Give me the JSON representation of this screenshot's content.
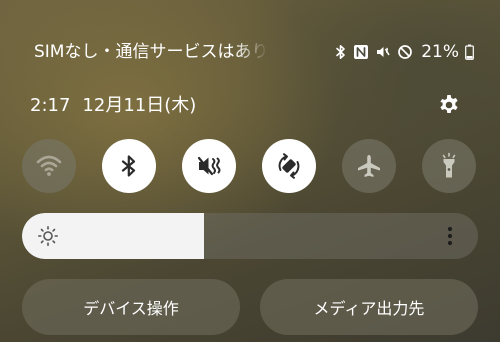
{
  "status_bar": {
    "carrier_text": "SIMなし・通信サービスはあり",
    "battery_percent": "21%",
    "icons": [
      "bluetooth-icon",
      "nfc-icon",
      "vibrate-mute-icon",
      "do-not-disturb-icon",
      "battery-icon"
    ],
    "battery_level": 0.21
  },
  "header": {
    "time": "2:17",
    "date": "12月11日(木)",
    "settings_icon": "gear-icon"
  },
  "quick_toggles": [
    {
      "name": "wifi",
      "icon": "wifi-icon",
      "state": "off"
    },
    {
      "name": "bluetooth",
      "icon": "bluetooth-icon",
      "state": "on"
    },
    {
      "name": "sound-mute",
      "icon": "mute-icon",
      "state": "on"
    },
    {
      "name": "auto-rotate",
      "icon": "auto-rotate-icon",
      "state": "on"
    },
    {
      "name": "airplane-mode",
      "icon": "airplane-icon",
      "state": "off"
    },
    {
      "name": "flashlight",
      "icon": "flashlight-icon",
      "state": "off"
    }
  ],
  "brightness": {
    "level": 0.4,
    "icon": "sun-icon",
    "more_icon": "more-vertical-icon"
  },
  "buttons": {
    "device_control": "デバイス操作",
    "media_output": "メディア出力先"
  },
  "colors": {
    "toggle_on_bg": "#ffffff",
    "toggle_on_icon": "#2b2b2b",
    "toggle_off_bg": "#78766880",
    "text": "#ffffff"
  }
}
